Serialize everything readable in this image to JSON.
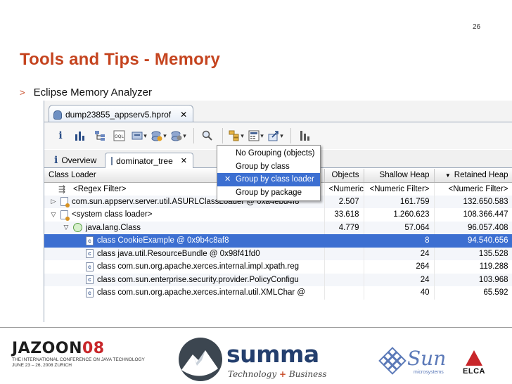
{
  "slide": {
    "number": "26",
    "title": "Tools and Tips - Memory",
    "bullet_marker": ">",
    "bullet_text": "Eclipse Memory Analyzer"
  },
  "editor": {
    "file_tab_label": "dump23855_appserv5.hprof",
    "close_glyph": "✕",
    "tabs": [
      {
        "label": "Overview"
      },
      {
        "label": "dominator_tree"
      }
    ],
    "toolbar_icons": [
      "info-icon",
      "histogram-icon",
      "dominator-tree-icon",
      "oql-icon",
      "thread-overview-icon",
      "run-report-icon",
      "heap-dump-queries-icon",
      "search-icon",
      "group-by-icon",
      "calculate-retained-size-icon",
      "export-icon",
      "chart-icon"
    ]
  },
  "group_menu": {
    "items": [
      {
        "label": "No Grouping (objects)",
        "checked": false
      },
      {
        "label": "Group by class",
        "checked": false
      },
      {
        "label": "Group by class loader",
        "checked": true
      },
      {
        "label": "Group by package",
        "checked": false
      }
    ],
    "check_glyph": "✕"
  },
  "table": {
    "columns": [
      "Class Loader",
      "Objects",
      "Shallow Heap",
      "Retained Heap"
    ],
    "sort_marker": "▼",
    "filter_row": {
      "name": "<Regex Filter>",
      "objects": "<Numeric Filter>",
      "shallow": "<Numeric Filter>",
      "retained": "<Numeric Filter>"
    },
    "rows": [
      {
        "indent": 0,
        "expander": "▷",
        "icon": "class-loader-object-icon",
        "name": "com.sun.appserv.server.util.ASURLClassLoader @ 0xa4ebd4f8",
        "objects": "2.507",
        "shallow": "161.759",
        "retained": "132.650.583",
        "selected": false
      },
      {
        "indent": 0,
        "expander": "▽",
        "icon": "class-loader-object-icon",
        "name": "<system class loader>",
        "objects": "33.618",
        "shallow": "1.260.623",
        "retained": "108.366.447",
        "selected": false
      },
      {
        "indent": 1,
        "expander": "▽",
        "icon": "class-icon",
        "name": "java.lang.Class",
        "objects": "4.779",
        "shallow": "57.064",
        "retained": "96.057.408",
        "selected": false
      },
      {
        "indent": 2,
        "expander": "",
        "icon": "class-object-icon",
        "name": "class CookieExample @ 0x9b4c8af8",
        "objects": "",
        "shallow": "8",
        "retained": "94.540.656",
        "selected": true
      },
      {
        "indent": 2,
        "expander": "",
        "icon": "class-object-icon",
        "name": "class java.util.ResourceBundle @ 0x98f41fd0",
        "objects": "",
        "shallow": "24",
        "retained": "135.528",
        "selected": false
      },
      {
        "indent": 2,
        "expander": "",
        "icon": "class-object-icon",
        "name": "class com.sun.org.apache.xerces.internal.impl.xpath.reg",
        "objects": "",
        "shallow": "264",
        "retained": "119.288",
        "selected": false
      },
      {
        "indent": 2,
        "expander": "",
        "icon": "class-object-icon",
        "name": "class com.sun.enterprise.security.provider.PolicyConfigu",
        "objects": "",
        "shallow": "24",
        "retained": "103.968",
        "selected": false
      },
      {
        "indent": 2,
        "expander": "",
        "icon": "class-object-icon",
        "name": "class com.sun.org.apache.xerces.internal.util.XMLChar @",
        "objects": "",
        "shallow": "40",
        "retained": "65.592",
        "selected": false
      }
    ]
  },
  "footer": {
    "jazoon_word": "JAZOON",
    "jazoon_year": "08",
    "jazoon_line1": "THE INTERNATIONAL CONFERENCE ON JAVA TECHNOLOGY",
    "jazoon_line2": "JUNE 23 – 26, 2008 ZURICH",
    "summa_word": "summa",
    "summa_tag_left": "Technology",
    "summa_tag_plus": "+",
    "summa_tag_right": "Business",
    "sun_word": "Sun",
    "sun_sub": "microsystems",
    "elca_word": "ELCA"
  },
  "colors": {
    "title": "#c5441f",
    "selection": "#3c6fd1",
    "summa_blue": "#243f6e",
    "sun_blue": "#5b79b8",
    "elca_red": "#c8262a"
  }
}
